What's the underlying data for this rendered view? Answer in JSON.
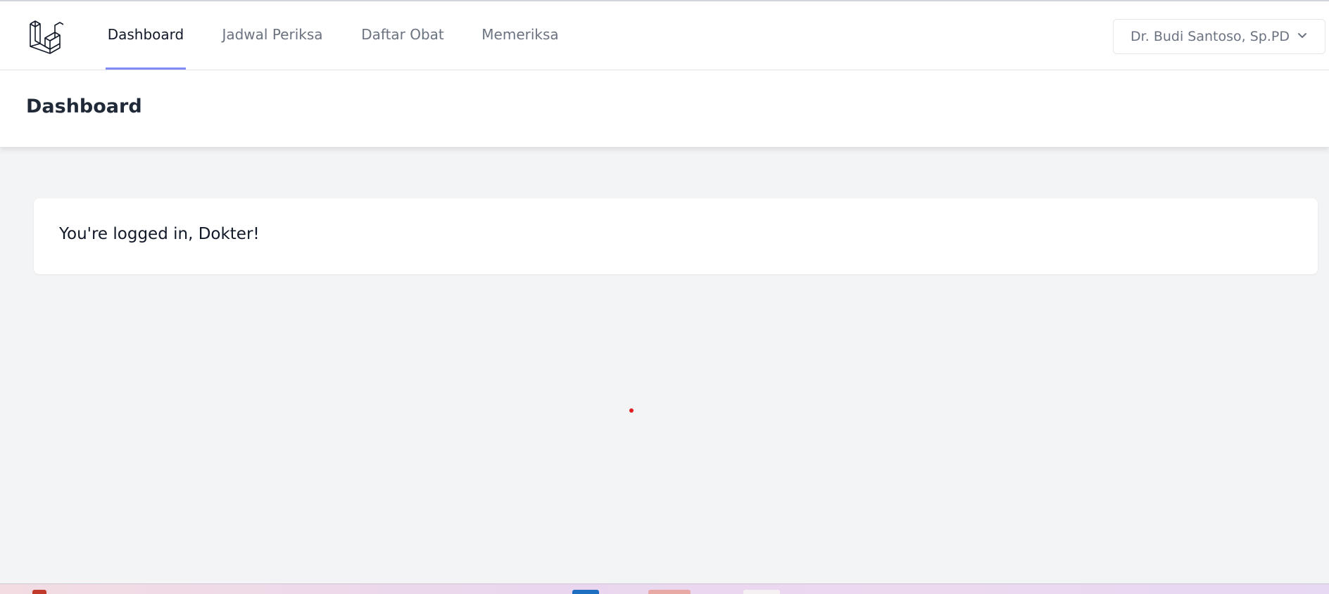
{
  "navbar": {
    "links": [
      {
        "label": "Dashboard",
        "active": true
      },
      {
        "label": "Jadwal Periksa",
        "active": false
      },
      {
        "label": "Daftar Obat",
        "active": false
      },
      {
        "label": "Memeriksa",
        "active": false
      }
    ],
    "user_name": "Dr. Budi Santoso, Sp.PD"
  },
  "header": {
    "title": "Dashboard"
  },
  "content": {
    "message": "You're logged in, Dokter!"
  },
  "colors": {
    "active_tab_underline": "#818cf8",
    "background": "#f3f4f6",
    "cursor_dot": "#e11d1d"
  }
}
